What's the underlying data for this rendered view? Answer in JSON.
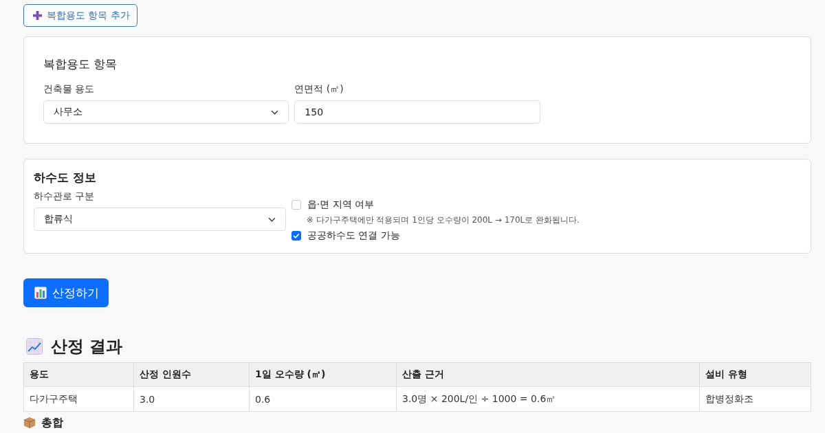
{
  "add_button": {
    "label": "복합용도 항목 추가"
  },
  "mixed_use_card": {
    "title": "복합용도 항목",
    "fields": [
      {
        "kind": "select",
        "label": "건축물 용도",
        "value": "사무소"
      },
      {
        "kind": "input",
        "label": "연면적 (㎡)",
        "value": "150"
      }
    ]
  },
  "sewer_card": {
    "title": "하수도 정보",
    "fields": [
      {
        "kind": "select",
        "label": "하수관로 구분",
        "value": "합류식"
      }
    ],
    "options": [
      {
        "label": "읍·면 지역 여부",
        "checked": false,
        "note": "※ 다가구주택에만 적용되며 1인당 오수량이 200L → 170L로 완화됩니다."
      },
      {
        "label": "공공하수도 연결 가능",
        "checked": true
      }
    ]
  },
  "calculate_button": {
    "label": "산정하기"
  },
  "results": {
    "title": "산정 결과",
    "table": {
      "columns": [
        "용도",
        "산정 인원수",
        "1일 오수량 (㎥)",
        "산출 근거",
        "설비 유형"
      ],
      "rows": [
        [
          "다가구주택",
          "3.0",
          "0.6",
          "3.0명 × 200L/인 ÷ 1000 = 0.6㎥",
          "합병정화조"
        ]
      ]
    }
  },
  "summary": {
    "title": "총합"
  }
}
